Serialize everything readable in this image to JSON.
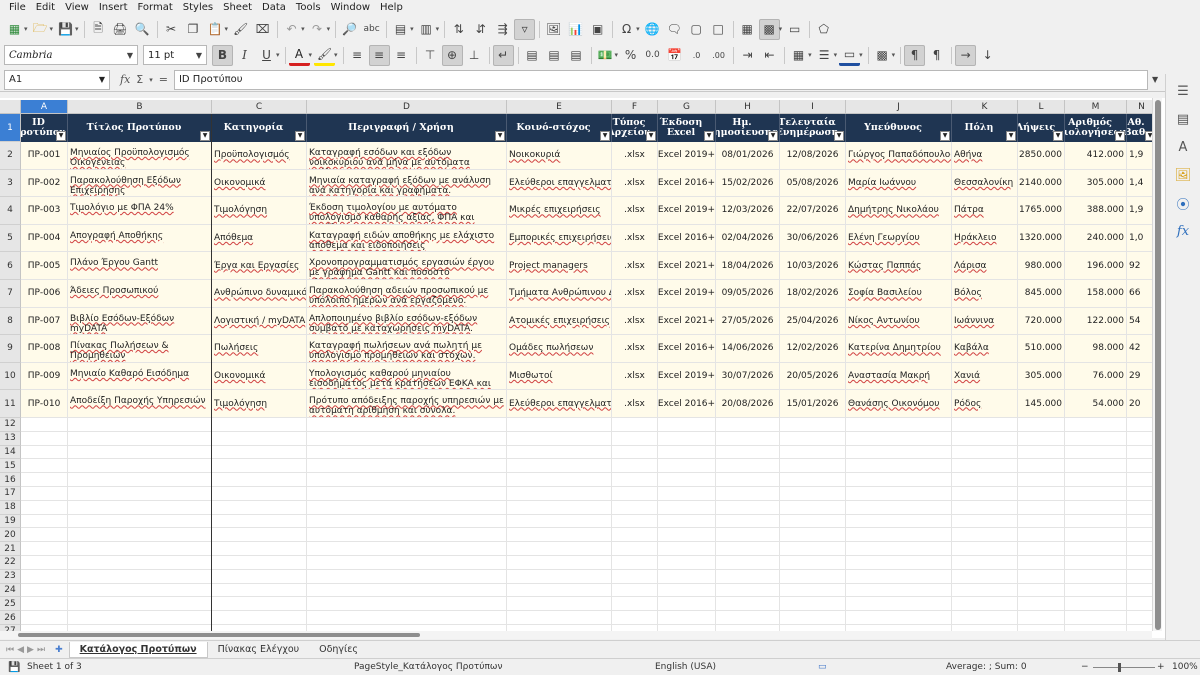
{
  "menu": [
    "File",
    "Edit",
    "View",
    "Insert",
    "Format",
    "Styles",
    "Sheet",
    "Data",
    "Tools",
    "Window",
    "Help"
  ],
  "format_toolbar": {
    "font_name": "Cambria",
    "font_size": "11 pt",
    "bold": "B",
    "italic": "I",
    "underline": "U",
    "percent": "%",
    "decimal": "0.0"
  },
  "formula": {
    "cell_ref": "A1",
    "content": "ID Προτύπου"
  },
  "columns": [
    {
      "letter": "A",
      "header": "ID Προτύπου"
    },
    {
      "letter": "B",
      "header": "Τίτλος Προτύπου"
    },
    {
      "letter": "C",
      "header": "Κατηγορία"
    },
    {
      "letter": "D",
      "header": "Περιγραφή / Χρήση"
    },
    {
      "letter": "E",
      "header": "Κοινό-στόχος"
    },
    {
      "letter": "F",
      "header": "Τύπος Αρχείου"
    },
    {
      "letter": "G",
      "header": "Έκδοση Excel"
    },
    {
      "letter": "H",
      "header": "Ημ. Δημοσίευσης"
    },
    {
      "letter": "I",
      "header": "Τελευταία Ενημέρωση"
    },
    {
      "letter": "J",
      "header": "Υπεύθυνος"
    },
    {
      "letter": "K",
      "header": "Πόλη"
    },
    {
      "letter": "L",
      "header": "Λήψεις"
    },
    {
      "letter": "M",
      "header": "Αριθμός Αξιολογήσεων"
    },
    {
      "letter": "N",
      "header": "Αθ. Βαθ."
    }
  ],
  "rows": [
    [
      "ΠΡ-001",
      "Μηνιαίος Προϋπολογισμός Οικογένειας",
      "Προϋπολογισμός",
      "Καταγραφή εσόδων και εξόδων νοικοκυριού ανά μήνα με αυτόματα υπόλοιπα.",
      "Νοικοκυριά",
      ".xlsx",
      "Excel 2019+",
      "08/01/2026",
      "12/08/2026",
      "Γιώργος Παπαδόπουλος",
      "Αθήνα",
      "2850.000",
      "412.000",
      "1,9"
    ],
    [
      "ΠΡ-002",
      "Παρακολούθηση Εξόδων Επιχείρησης",
      "Οικονομικά",
      "Μηνιαία καταγραφή εξόδων με ανάλυση ανά κατηγορία και γραφήματα.",
      "Ελεύθεροι επαγγελματίες",
      ".xlsx",
      "Excel 2016+",
      "15/02/2026",
      "05/08/2026",
      "Μαρία Ιωάννου",
      "Θεσσαλονίκη",
      "2140.000",
      "305.000",
      "1,4"
    ],
    [
      "ΠΡ-003",
      "Τιμολόγιο με ΦΠΑ 24%",
      "Τιμολόγηση",
      "Έκδοση τιμολογίου με αυτόματο υπολογισμό καθαρής αξίας, ΦΠΑ και συνόλου.",
      "Μικρές επιχειρήσεις",
      ".xlsx",
      "Excel 2019+",
      "12/03/2026",
      "22/07/2026",
      "Δημήτρης Νικολάου",
      "Πάτρα",
      "1765.000",
      "388.000",
      "1,9"
    ],
    [
      "ΠΡ-004",
      "Απογραφή Αποθήκης",
      "Απόθεμα",
      "Καταγραφή ειδών αποθήκης με ελάχιστο απόθεμα και ειδοποιήσεις επαναπαραγγελίας.",
      "Εμπορικές επιχειρήσεις",
      ".xlsx",
      "Excel 2016+",
      "02/04/2026",
      "30/06/2026",
      "Ελένη Γεωργίου",
      "Ηράκλειο",
      "1320.000",
      "240.000",
      "1,0"
    ],
    [
      "ΠΡ-005",
      "Πλάνο Έργου Gantt",
      "Έργα και Εργασίες",
      "Χρονοπρογραμματισμός εργασιών έργου με γράφημα Gantt και ποσοστό ολοκλήρωσης.",
      "Project managers",
      ".xlsx",
      "Excel 2021+",
      "18/04/2026",
      "10/03/2026",
      "Κώστας Παππάς",
      "Λάρισα",
      "980.000",
      "196.000",
      "92"
    ],
    [
      "ΠΡ-006",
      "Άδειες Προσωπικού",
      "Ανθρώπινο δυναμικό",
      "Παρακολούθηση αδειών προσωπικού με υπόλοιπο ημερών ανά εργαζόμενο.",
      "Τμήματα Ανθρώπινου Δυναμικού",
      ".xlsx",
      "Excel 2019+",
      "09/05/2026",
      "18/02/2026",
      "Σοφία Βασιλείου",
      "Βόλος",
      "845.000",
      "158.000",
      "66"
    ],
    [
      "ΠΡ-007",
      "Βιβλίο Εσόδων-Εξόδων myDATA",
      "Λογιστική / myDATA",
      "Απλοποιημένο βιβλίο εσόδων-εξόδων συμβατό με καταχωρήσεις myDATA.",
      "Ατομικές επιχειρήσεις",
      ".xlsx",
      "Excel 2021+",
      "27/05/2026",
      "25/04/2026",
      "Νίκος Αντωνίου",
      "Ιωάννινα",
      "720.000",
      "122.000",
      "54"
    ],
    [
      "ΠΡ-008",
      "Πίνακας Πωλήσεων & Προμηθειών",
      "Πωλήσεις",
      "Καταγραφή πωλήσεων ανά πωλητή με υπολογισμό προμηθειών και στόχων.",
      "Ομάδες πωλήσεων",
      ".xlsx",
      "Excel 2016+",
      "14/06/2026",
      "12/02/2026",
      "Κατερίνα Δημητρίου",
      "Καβάλα",
      "510.000",
      "98.000",
      "42"
    ],
    [
      "ΠΡ-009",
      "Μηνιαίο Καθαρό Εισόδημα",
      "Οικονομικά",
      "Υπολογισμός καθαρού μηνιαίου εισοδήματος μετά κρατήσεων ΕΦΚΑ και φόρου.",
      "Μισθωτοί",
      ".xlsx",
      "Excel 2019+",
      "30/07/2026",
      "20/05/2026",
      "Αναστασία Μακρή",
      "Χανιά",
      "305.000",
      "76.000",
      "29"
    ],
    [
      "ΠΡ-010",
      "Αποδείξη Παροχής Υπηρεσιών",
      "Τιμολόγηση",
      "Πρότυπο απόδειξης παροχής υπηρεσιών με αυτόματη αρίθμηση και σύνολα.",
      "Ελεύθεροι επαγγελματίες",
      ".xlsx",
      "Excel 2016+",
      "20/08/2026",
      "15/01/2026",
      "Θανάσης Οικονόμου",
      "Ρόδος",
      "145.000",
      "54.000",
      "20"
    ]
  ],
  "empty_rows": [
    "12",
    "13",
    "14",
    "15",
    "16",
    "17",
    "18",
    "19",
    "20",
    "21",
    "22",
    "23",
    "24",
    "25",
    "26",
    "27"
  ],
  "tabs": [
    "Κατάλογος Προτύπων",
    "Πίνακας Ελέγχου",
    "Οδηγίες"
  ],
  "status": {
    "sheet": "Sheet 1 of 3",
    "page_style": "PageStyle_Κατάλογος Προτύπων",
    "language": "English (USA)",
    "summary": "Average: ; Sum: 0",
    "zoom": "100%"
  },
  "colors": {
    "header_bg": "#1f3552",
    "selection": "#3b7fd4",
    "row_fill": "#fffbea"
  }
}
